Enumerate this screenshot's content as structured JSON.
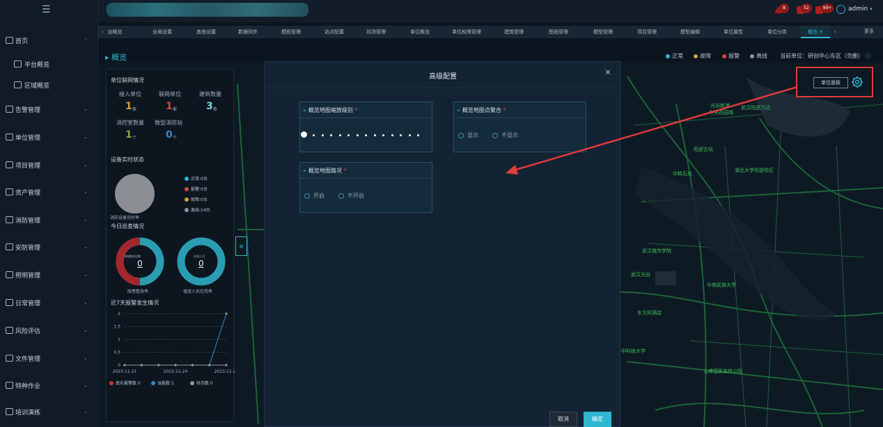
{
  "sidebar": {
    "items": [
      {
        "label": "首页",
        "icon": "monitor-icon"
      },
      {
        "label": "平台概览",
        "icon": "image-icon",
        "sub": true
      },
      {
        "label": "区域概览",
        "icon": "building-icon",
        "sub": true
      },
      {
        "label": "告警管理",
        "icon": "bell-icon"
      },
      {
        "label": "单位管理",
        "icon": "user-icon"
      },
      {
        "label": "项目管理",
        "icon": "project-icon"
      },
      {
        "label": "资产管理",
        "icon": "asset-icon"
      },
      {
        "label": "消防管理",
        "icon": "fire-icon"
      },
      {
        "label": "安防管理",
        "icon": "shield-icon"
      },
      {
        "label": "照明管理",
        "icon": "bulb-icon"
      },
      {
        "label": "日常管理",
        "icon": "users-icon"
      },
      {
        "label": "风险评估",
        "icon": "gear-icon"
      },
      {
        "label": "文件管理",
        "icon": "folder-icon"
      },
      {
        "label": "特种作业",
        "icon": "toolbox-icon"
      },
      {
        "label": "培训演练",
        "icon": "people-icon"
      }
    ]
  },
  "header": {
    "notifications": [
      {
        "count": "8"
      },
      {
        "count": "52"
      },
      {
        "count": "99+"
      }
    ],
    "user": "admin"
  },
  "tabs": [
    "台概览",
    "全局设置",
    "其他设置",
    "数据同步",
    "模板管理",
    "站点配置",
    "风场管理",
    "单位概览",
    "单位权限管理",
    "建筑管理",
    "图纸管理",
    "模型管理",
    "项目管理",
    "模型编辑",
    "单位属性",
    "单位分类",
    "概览"
  ],
  "tabs_more": "更多",
  "breadcrumb": "▸ 概览",
  "status_legend": [
    {
      "label": "正常",
      "color": "#2fb7d1"
    },
    {
      "label": "故障",
      "color": "#d2a13a"
    },
    {
      "label": "报警",
      "color": "#d94545"
    },
    {
      "label": "离线",
      "color": "#8a96a2"
    }
  ],
  "current_unit": "当前单位：研创中心东区（勿删）",
  "stats": {
    "networking_title": "单位联网情况",
    "access_units_label": "接入单位",
    "access_units_value": "1",
    "access_units_unit": "家",
    "network_units_label": "联网单位",
    "network_units_value": "1",
    "network_units_unit": "家",
    "buildings_label": "建筑数量",
    "buildings_value": "3",
    "buildings_unit": "栋",
    "fire_rooms_label": "消控室数量",
    "fire_rooms_value": "1",
    "fire_rooms_unit": "个",
    "micro_stations_label": "微型消防站",
    "micro_stations_value": "0",
    "micro_stations_unit": "个",
    "device_status_title": "设备实时状态",
    "device_legend": [
      {
        "label": "正常:0台",
        "color": "#2fb7d1"
      },
      {
        "label": "报警:0台",
        "color": "#d94545"
      },
      {
        "label": "故障:0台",
        "color": "#d2a13a"
      },
      {
        "label": "离线:14台",
        "color": "#8a96a2"
      }
    ],
    "device_rate_label": "消防设备完好率",
    "patrol_title": "今日巡查情况",
    "hazard_inner_label": "隐患整改总数",
    "hazard_value": "0",
    "hazard_label": "隐患整改率",
    "patrol_inner_label": "在岗人员",
    "patrol_value": "0",
    "patrol_label": "值班人员在岗率",
    "alarm_trend_title": "近7天报警发生情况"
  },
  "chart_data": {
    "type": "line",
    "title": "近7天报警发生情况",
    "x": [
      "2023-11-21",
      "2023-11-22",
      "2023-11-23",
      "2023-11-24",
      "2023-11-25",
      "2023-11-26",
      "2023-11-27"
    ],
    "x_tick_labels": [
      "2023-11-21",
      "2023-11-24",
      "2023-11-27"
    ],
    "ylim": [
      0,
      2
    ],
    "y_ticks": [
      "0",
      "0.5",
      "1",
      "1.5",
      "2"
    ],
    "series": [
      {
        "name": "真实报警数 0",
        "color": "#c8333a",
        "values": [
          0,
          0,
          0,
          0,
          0,
          0,
          0
        ]
      },
      {
        "name": "误报数 2",
        "color": "#3a86c8",
        "values": [
          0,
          0,
          0,
          0,
          0,
          0,
          2
        ]
      },
      {
        "name": "待办数 0",
        "color": "#8a96a2",
        "values": [
          0,
          0,
          0,
          0,
          0,
          0,
          0
        ]
      }
    ]
  },
  "dialog": {
    "title": "高级配置",
    "zoom_card_title": "概览地图缩放级别",
    "cluster_card_title": "概览地图点聚合",
    "cluster_options": [
      "显示",
      "不显示"
    ],
    "traffic_card_title": "概览地图路况",
    "traffic_options": [
      "开启",
      "不开启"
    ],
    "required_mark": "*",
    "cancel_label": "取消",
    "ok_label": "确定"
  },
  "map_overlay": {
    "unit_panel_label": "单位面板",
    "labels": [
      "光谷新港",
      "中央花园城",
      "武汉阳逻万达",
      "阳逻古站",
      "中韩石化",
      "湖北大学阳逻校区",
      "武汉城市学院",
      "武汉光谷",
      "东方知酒店",
      "中南民族大学",
      "华中科技大学",
      "九峰国家森林公园",
      "武汉东站"
    ]
  }
}
